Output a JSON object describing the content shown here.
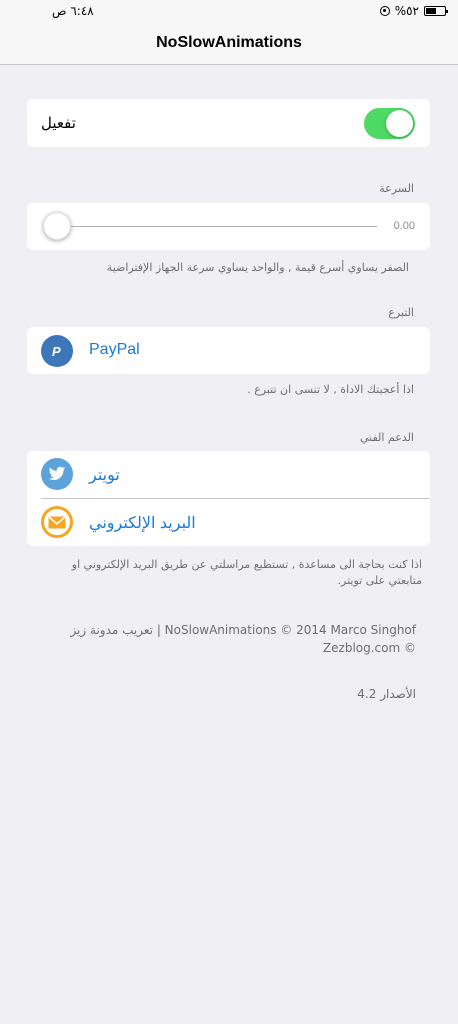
{
  "status_bar": {
    "time": "٦:٤٨ ص",
    "battery": "%٥٢"
  },
  "nav": {
    "title": "NoSlowAnimations"
  },
  "enable": {
    "label": "تفعيل",
    "on": true
  },
  "speed": {
    "header": "السرعة",
    "value": "0.00",
    "level": 0,
    "footer": "الصفر يساوي أسرع قيمة , والواحد يساوي سرعة الجهاز الإفتراضية"
  },
  "donate": {
    "header": "التبرع",
    "item_label": "PayPal",
    "footer": "اذا أعجبتك الاداة , لا تنسى ان تتبرع ."
  },
  "support": {
    "header": "الدعم الفني",
    "items": [
      {
        "label": "تويتر",
        "icon": "twitter-icon"
      },
      {
        "label": "البريد الإلكتروني",
        "icon": "mail-icon"
      }
    ],
    "footer": "اذا كنت بحاجة الى مساعدة , تستطيع مراسلتي عن طريق البريد الإلكتروني او متابعتي على تويتر."
  },
  "credits": {
    "line1": "تعريب مدونة زيز | NoSlowAnimations © 2014 Marco Singhof",
    "line2": "Zezblog.com ©"
  },
  "version": "الأصدار 4.2",
  "colors": {
    "toggle_on": "#4cd964",
    "link": "#1a7ad4",
    "paypal": "#3d76b9",
    "twitter": "#5ba3d9",
    "mail": "#f5a623"
  }
}
